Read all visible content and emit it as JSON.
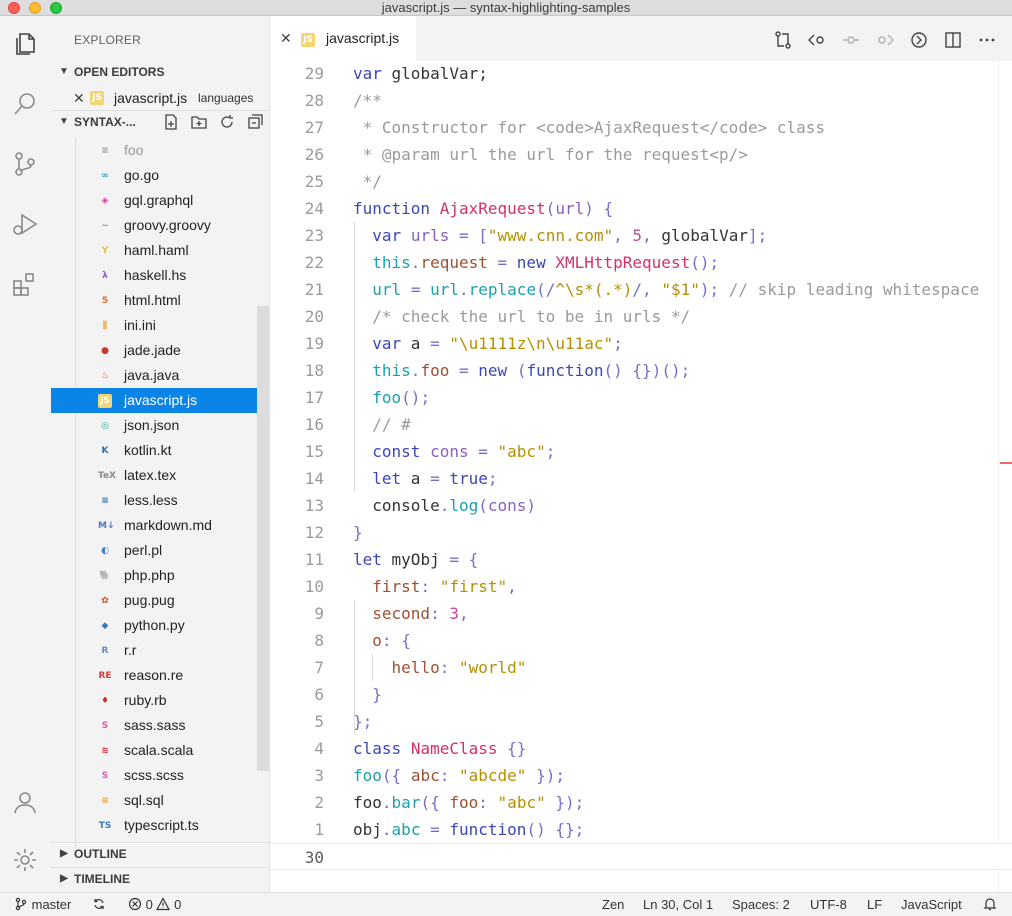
{
  "window": {
    "title": "javascript.js — syntax-highlighting-samples"
  },
  "activity_bar": {
    "icons": [
      "files-icon",
      "search-icon",
      "source-control-icon",
      "run-debug-icon",
      "extensions-icon",
      "account-icon",
      "settings-gear-icon"
    ]
  },
  "sidebar": {
    "title": "EXPLORER",
    "open_editors_label": "OPEN EDITORS",
    "open_editor": {
      "name": "javascript.js",
      "description": "languages",
      "badge": "JS"
    },
    "folder_label": "SYNTAX-...",
    "files": [
      {
        "name": "foo",
        "badge": "≡",
        "color": "#9a9a9a",
        "dim": true
      },
      {
        "name": "go.go",
        "badge": "∞",
        "color": "#2ea0c8"
      },
      {
        "name": "gql.graphql",
        "badge": "◈",
        "color": "#e535ab"
      },
      {
        "name": "groovy.groovy",
        "badge": "~",
        "color": "#6aa5c8"
      },
      {
        "name": "haml.haml",
        "badge": "Y",
        "color": "#e8b83a"
      },
      {
        "name": "haskell.hs",
        "badge": "λ",
        "color": "#8e5ad0"
      },
      {
        "name": "html.html",
        "badge": "5",
        "color": "#e8692a"
      },
      {
        "name": "ini.ini",
        "badge": "⫼",
        "color": "#f0a23a"
      },
      {
        "name": "jade.jade",
        "badge": "●",
        "color": "#c0392b"
      },
      {
        "name": "java.java",
        "badge": "♨",
        "color": "#e0543a"
      },
      {
        "name": "javascript.js",
        "badge": "JS",
        "color": "#e8c23a",
        "selected": true
      },
      {
        "name": "json.json",
        "badge": "◎",
        "color": "#2eaa9a"
      },
      {
        "name": "kotlin.kt",
        "badge": "K",
        "color": "#2a6da8"
      },
      {
        "name": "latex.tex",
        "badge": "TeX",
        "color": "#8a8a8a"
      },
      {
        "name": "less.less",
        "badge": "≡",
        "color": "#2a6da8"
      },
      {
        "name": "markdown.md",
        "badge": "M↓",
        "color": "#4a7bc0"
      },
      {
        "name": "perl.pl",
        "badge": "◐",
        "color": "#3a7fc8"
      },
      {
        "name": "php.php",
        "badge": "🐘",
        "color": "#4a7ab8"
      },
      {
        "name": "pug.pug",
        "badge": "✿",
        "color": "#c84a3a"
      },
      {
        "name": "python.py",
        "badge": "◆",
        "color": "#3a7ab8"
      },
      {
        "name": "r.r",
        "badge": "R",
        "color": "#6a8ac0"
      },
      {
        "name": "reason.re",
        "badge": "RE",
        "color": "#d0453a"
      },
      {
        "name": "ruby.rb",
        "badge": "♦",
        "color": "#c8302a"
      },
      {
        "name": "sass.sass",
        "badge": "S",
        "color": "#cf649a"
      },
      {
        "name": "scala.scala",
        "badge": "≋",
        "color": "#d0303a"
      },
      {
        "name": "scss.scss",
        "badge": "S",
        "color": "#cf649a"
      },
      {
        "name": "sql.sql",
        "badge": "≡",
        "color": "#e8a23a"
      },
      {
        "name": "typescript.ts",
        "badge": "TS",
        "color": "#3a7ab8"
      }
    ],
    "outline_label": "OUTLINE",
    "timeline_label": "TIMELINE"
  },
  "tab": {
    "name": "javascript.js",
    "badge": "JS"
  },
  "tab_actions": [
    "compare-changes-icon",
    "go-back-icon",
    "commit-icon",
    "go-forward-icon",
    "open-preview-icon",
    "split-editor-icon",
    "more-actions-icon"
  ],
  "editor": {
    "lines": [
      {
        "n": "29",
        "html": "<span class='k'>var</span> globalVar;"
      },
      {
        "n": "28",
        "html": "<span class='c'>/**</span>"
      },
      {
        "n": "27",
        "html": "<span class='c'> * Constructor for &lt;code&gt;AjaxRequest&lt;/code&gt; class</span>"
      },
      {
        "n": "26",
        "html": "<span class='c'> * @param url the url for the request&lt;p/&gt;</span>"
      },
      {
        "n": "25",
        "html": "<span class='c'> */</span>"
      },
      {
        "n": "24",
        "html": "<span class='k'>function</span> <span class='r'>AjaxRequest</span><span class='o'>(</span><span class='n'>url</span><span class='o'>)</span> <span class='o'>{</span>"
      },
      {
        "n": "23",
        "html": "  <span class='k'>var</span> <span class='n'>urls</span> <span class='o'>=</span> <span class='o'>[</span><span class='s'>\"www.cnn.com\"</span><span class='o'>,</span> <span class='p'>5</span><span class='o'>,</span> globalVar<span class='o'>];</span>"
      },
      {
        "n": "22",
        "html": "  <span class='b'>this</span><span class='o'>.</span><span class='v'>request</span> <span class='o'>=</span> <span class='k'>new</span> <span class='r'>XMLHttpRequest</span><span class='o'>();</span>"
      },
      {
        "n": "21",
        "html": "  <span class='b'>url</span> <span class='o'>=</span> <span class='b'>url</span><span class='o'>.</span><span class='b'>replace</span><span class='o'>(/</span><span class='s'>^\\s*(.*)</span><span class='o'>/,</span> <span class='s'>\"$1\"</span><span class='o'>);</span> <span class='c'>// skip leading whitespace</span>"
      },
      {
        "n": "20",
        "html": "  <span class='c'>/* check the url to be in urls */</span>"
      },
      {
        "n": "19",
        "html": "  <span class='k'>var</span> a <span class='o'>=</span> <span class='s'>\"\\u1111z\\n\\u11ac\"</span><span class='o'>;</span>"
      },
      {
        "n": "18",
        "html": "  <span class='b'>this</span><span class='o'>.</span><span class='v'>foo</span> <span class='o'>=</span> <span class='k'>new</span> <span class='o'>(</span><span class='k'>function</span><span class='o'>()</span> <span class='o'>{})();</span>"
      },
      {
        "n": "17",
        "html": "  <span class='b'>foo</span><span class='o'>();</span>"
      },
      {
        "n": "16",
        "html": "  <span class='c'>// #</span>"
      },
      {
        "n": "15",
        "html": "  <span class='k'>const</span> <span class='n'>cons</span> <span class='o'>=</span> <span class='s'>\"abc\"</span><span class='o'>;</span>"
      },
      {
        "n": "14",
        "html": "  <span class='k'>let</span> a <span class='o'>=</span> <span class='k'>true</span><span class='o'>;</span>"
      },
      {
        "n": "13",
        "html": "  console<span class='o'>.</span><span class='b'>log</span><span class='o'>(</span><span class='n'>cons</span><span class='o'>)</span>"
      },
      {
        "n": "12",
        "html": "<span class='o'>}</span>"
      },
      {
        "n": "11",
        "html": "<span class='k'>let</span> myObj <span class='o'>=</span> <span class='o'>{</span>"
      },
      {
        "n": "10",
        "html": "  <span class='v'>first</span><span class='o'>:</span> <span class='s'>\"first\"</span><span class='o'>,</span>"
      },
      {
        "n": "9",
        "html": "  <span class='v'>second</span><span class='o'>:</span> <span class='p'>3</span><span class='o'>,</span>"
      },
      {
        "n": "8",
        "html": "  <span class='v'>o</span><span class='o'>:</span> <span class='o'>{</span>"
      },
      {
        "n": "7",
        "html": "    <span class='v'>hello</span><span class='o'>:</span> <span class='s'>\"world\"</span>"
      },
      {
        "n": "6",
        "html": "  <span class='o'>}</span>"
      },
      {
        "n": "5",
        "html": "<span class='o'>};</span>"
      },
      {
        "n": "4",
        "html": "<span class='k'>class</span> <span class='r'>NameClass</span> <span class='o'>{}</span>"
      },
      {
        "n": "3",
        "html": "<span class='b'>foo</span><span class='o'>({</span> <span class='v'>abc</span><span class='o'>:</span> <span class='s'>\"abcde\"</span> <span class='o'>});</span>"
      },
      {
        "n": "2",
        "html": "foo<span class='o'>.</span><span class='b'>bar</span><span class='o'>({</span> <span class='v'>foo</span><span class='o'>:</span> <span class='s'>\"abc\"</span> <span class='o'>});</span>"
      },
      {
        "n": "1",
        "html": "obj<span class='o'>.</span><span class='b'>abc</span> <span class='o'>=</span> <span class='k'>function</span><span class='o'>()</span> <span class='o'>{};</span>"
      },
      {
        "n": "30",
        "html": "",
        "current": true
      }
    ]
  },
  "status": {
    "branch": "master",
    "errors": "0",
    "warnings": "0",
    "zen": "Zen",
    "position": "Ln 30, Col 1",
    "spaces": "Spaces: 2",
    "encoding": "UTF-8",
    "eol": "LF",
    "language": "JavaScript"
  }
}
